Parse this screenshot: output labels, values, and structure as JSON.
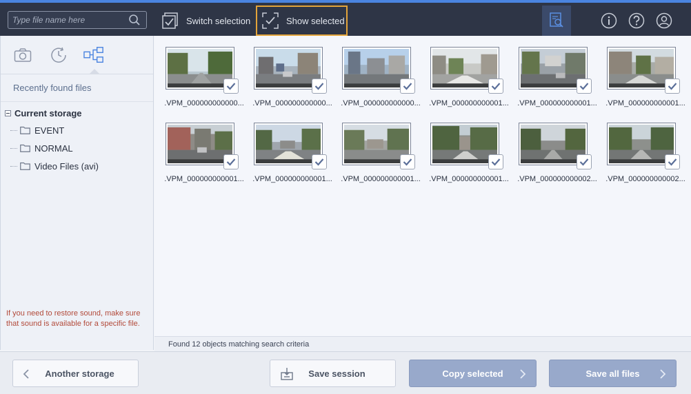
{
  "search": {
    "placeholder": "Type file name here"
  },
  "toolbar": {
    "switch_selection": "Switch selection",
    "show_selected": "Show selected"
  },
  "sidebar": {
    "recent_label": "Recently found files",
    "tree_root": "Current storage",
    "folders": [
      {
        "label": "EVENT"
      },
      {
        "label": "NORMAL"
      },
      {
        "label": "Video Files (avi)"
      }
    ],
    "hint": "If you need to restore sound, make sure that sound is available for a specific file."
  },
  "files": [
    {
      "name": ".VPM_000000000000...",
      "checked": true
    },
    {
      "name": ".VPM_000000000000...",
      "checked": true
    },
    {
      "name": ".VPM_000000000000...",
      "checked": true
    },
    {
      "name": ".VPM_000000000001...",
      "checked": true
    },
    {
      "name": ".VPM_000000000001...",
      "checked": true
    },
    {
      "name": ".VPM_000000000001...",
      "checked": true
    },
    {
      "name": ".VPM_000000000001...",
      "checked": true
    },
    {
      "name": ".VPM_000000000001...",
      "checked": true
    },
    {
      "name": ".VPM_000000000001...",
      "checked": true
    },
    {
      "name": ".VPM_000000000001...",
      "checked": true
    },
    {
      "name": ".VPM_000000000002...",
      "checked": true
    },
    {
      "name": ".VPM_000000000002...",
      "checked": true
    }
  ],
  "status": "Found 12 objects matching search criteria",
  "bottom": {
    "another_storage": "Another storage",
    "save_session": "Save session",
    "copy_selected": "Copy selected",
    "save_all": "Save all files"
  },
  "colors": {
    "topbar": "#2e3546",
    "accent": "#4a84e0",
    "highlight_border": "#e3a43a",
    "primary_button": "#98a9cb"
  }
}
